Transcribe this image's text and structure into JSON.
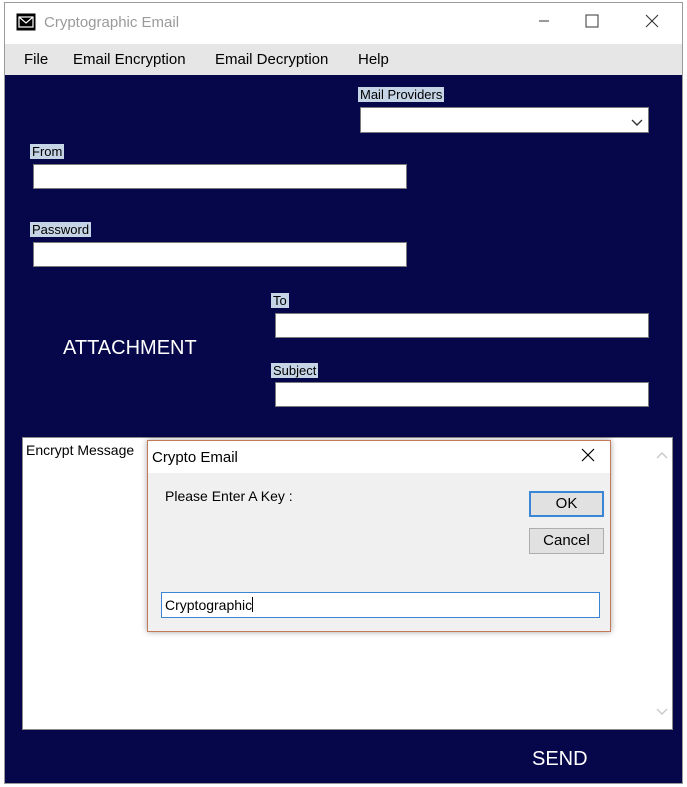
{
  "window": {
    "title": "Cryptographic Email"
  },
  "menu": {
    "items": [
      "File",
      "Email Encryption",
      "Email Decryption",
      "Help"
    ]
  },
  "form": {
    "mail_providers_label": "Mail Providers",
    "from_label": "From",
    "password_label": "Password",
    "to_label": "To",
    "subject_label": "Subject",
    "attachment_text": "ATTACHMENT",
    "message_label": "Encrypt Message",
    "send_label": "SEND"
  },
  "dialog": {
    "title": "Crypto Email",
    "prompt": "Please Enter A Key :",
    "ok_label": "OK",
    "cancel_label": "Cancel",
    "key_value": "Cryptographic"
  },
  "colors": {
    "client_background": "#06064a",
    "label_background": "#c6d5e6",
    "focus_accent": "#3a86d4"
  },
  "icons": {
    "app": "envelope-icon",
    "minimize": "minimize-icon",
    "maximize": "maximize-icon",
    "close": "close-icon",
    "dropdown": "chevron-down-icon"
  }
}
